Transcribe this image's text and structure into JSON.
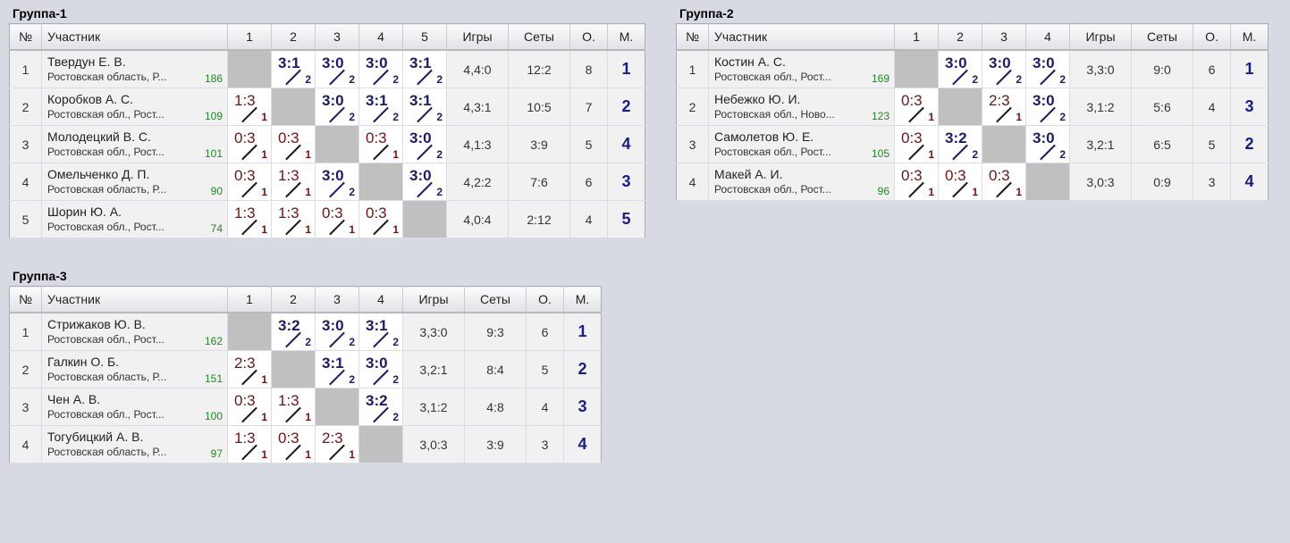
{
  "groups": [
    {
      "title": "Группа-1",
      "headers": {
        "num": "№",
        "name": "Участник",
        "games": "Игры",
        "sets": "Сеты",
        "points": "О.",
        "place": "М."
      },
      "rounds": [
        "1",
        "2",
        "3",
        "4",
        "5"
      ],
      "rows": [
        {
          "num": "1",
          "name": "Твердун Е. В.",
          "region": "Ростовская область, Р...",
          "rating": "186",
          "results": [
            {
              "self": true
            },
            {
              "score": "3:1",
              "pos": "2",
              "win": true
            },
            {
              "score": "3:0",
              "pos": "2",
              "win": true
            },
            {
              "score": "3:0",
              "pos": "2",
              "win": true
            },
            {
              "score": "3:1",
              "pos": "2",
              "win": true
            }
          ],
          "games": "4,4:0",
          "sets": "12:2",
          "points": "8",
          "place": "1"
        },
        {
          "num": "2",
          "name": "Коробков А. С.",
          "region": "Ростовская обл., Рост...",
          "rating": "109",
          "results": [
            {
              "score": "1:3",
              "pos": "1",
              "win": false
            },
            {
              "self": true
            },
            {
              "score": "3:0",
              "pos": "2",
              "win": true
            },
            {
              "score": "3:1",
              "pos": "2",
              "win": true
            },
            {
              "score": "3:1",
              "pos": "2",
              "win": true
            }
          ],
          "games": "4,3:1",
          "sets": "10:5",
          "points": "7",
          "place": "2"
        },
        {
          "num": "3",
          "name": "Молодецкий В. С.",
          "region": "Ростовская обл., Рост...",
          "rating": "101",
          "results": [
            {
              "score": "0:3",
              "pos": "1",
              "win": false
            },
            {
              "score": "0:3",
              "pos": "1",
              "win": false
            },
            {
              "self": true
            },
            {
              "score": "0:3",
              "pos": "1",
              "win": false
            },
            {
              "score": "3:0",
              "pos": "2",
              "win": true
            }
          ],
          "games": "4,1:3",
          "sets": "3:9",
          "points": "5",
          "place": "4"
        },
        {
          "num": "4",
          "name": "Омельченко Д. П.",
          "region": "Ростовская область, Р...",
          "rating": "90",
          "results": [
            {
              "score": "0:3",
              "pos": "1",
              "win": false
            },
            {
              "score": "1:3",
              "pos": "1",
              "win": false
            },
            {
              "score": "3:0",
              "pos": "2",
              "win": true
            },
            {
              "self": true
            },
            {
              "score": "3:0",
              "pos": "2",
              "win": true
            }
          ],
          "games": "4,2:2",
          "sets": "7:6",
          "points": "6",
          "place": "3"
        },
        {
          "num": "5",
          "name": "Шорин Ю. А.",
          "region": "Ростовская обл., Рост...",
          "rating": "74",
          "results": [
            {
              "score": "1:3",
              "pos": "1",
              "win": false
            },
            {
              "score": "1:3",
              "pos": "1",
              "win": false
            },
            {
              "score": "0:3",
              "pos": "1",
              "win": false
            },
            {
              "score": "0:3",
              "pos": "1",
              "win": false
            },
            {
              "self": true
            }
          ],
          "games": "4,0:4",
          "sets": "2:12",
          "points": "4",
          "place": "5"
        }
      ]
    },
    {
      "title": "Группа-2",
      "headers": {
        "num": "№",
        "name": "Участник",
        "games": "Игры",
        "sets": "Сеты",
        "points": "О.",
        "place": "М."
      },
      "rounds": [
        "1",
        "2",
        "3",
        "4"
      ],
      "rows": [
        {
          "num": "1",
          "name": "Костин А. С.",
          "region": "Ростовская обл., Рост...",
          "rating": "169",
          "results": [
            {
              "self": true
            },
            {
              "score": "3:0",
              "pos": "2",
              "win": true
            },
            {
              "score": "3:0",
              "pos": "2",
              "win": true
            },
            {
              "score": "3:0",
              "pos": "2",
              "win": true
            }
          ],
          "games": "3,3:0",
          "sets": "9:0",
          "points": "6",
          "place": "1"
        },
        {
          "num": "2",
          "name": "Небежко Ю. И.",
          "region": "Ростовская обл., Ново...",
          "rating": "123",
          "results": [
            {
              "score": "0:3",
              "pos": "1",
              "win": false
            },
            {
              "self": true
            },
            {
              "score": "2:3",
              "pos": "1",
              "win": false
            },
            {
              "score": "3:0",
              "pos": "2",
              "win": true
            }
          ],
          "games": "3,1:2",
          "sets": "5:6",
          "points": "4",
          "place": "3"
        },
        {
          "num": "3",
          "name": "Самолетов Ю. Е.",
          "region": "Ростовская обл., Рост...",
          "rating": "105",
          "results": [
            {
              "score": "0:3",
              "pos": "1",
              "win": false
            },
            {
              "score": "3:2",
              "pos": "2",
              "win": true
            },
            {
              "self": true
            },
            {
              "score": "3:0",
              "pos": "2",
              "win": true
            }
          ],
          "games": "3,2:1",
          "sets": "6:5",
          "points": "5",
          "place": "2"
        },
        {
          "num": "4",
          "name": "Макей А. И.",
          "region": "Ростовская обл., Рост...",
          "rating": "96",
          "results": [
            {
              "score": "0:3",
              "pos": "1",
              "win": false
            },
            {
              "score": "0:3",
              "pos": "1",
              "win": false
            },
            {
              "score": "0:3",
              "pos": "1",
              "win": false
            },
            {
              "self": true
            }
          ],
          "games": "3,0:3",
          "sets": "0:9",
          "points": "3",
          "place": "4"
        }
      ]
    },
    {
      "title": "Группа-3",
      "headers": {
        "num": "№",
        "name": "Участник",
        "games": "Игры",
        "sets": "Сеты",
        "points": "О.",
        "place": "М."
      },
      "rounds": [
        "1",
        "2",
        "3",
        "4"
      ],
      "rows": [
        {
          "num": "1",
          "name": "Стрижаков Ю. В.",
          "region": "Ростовская обл., Рост...",
          "rating": "162",
          "results": [
            {
              "self": true
            },
            {
              "score": "3:2",
              "pos": "2",
              "win": true
            },
            {
              "score": "3:0",
              "pos": "2",
              "win": true
            },
            {
              "score": "3:1",
              "pos": "2",
              "win": true
            }
          ],
          "games": "3,3:0",
          "sets": "9:3",
          "points": "6",
          "place": "1"
        },
        {
          "num": "2",
          "name": "Галкин О. Б.",
          "region": "Ростовская область, Р...",
          "rating": "151",
          "results": [
            {
              "score": "2:3",
              "pos": "1",
              "win": false
            },
            {
              "self": true
            },
            {
              "score": "3:1",
              "pos": "2",
              "win": true
            },
            {
              "score": "3:0",
              "pos": "2",
              "win": true
            }
          ],
          "games": "3,2:1",
          "sets": "8:4",
          "points": "5",
          "place": "2"
        },
        {
          "num": "3",
          "name": "Чен А. В.",
          "region": "Ростовская обл., Рост...",
          "rating": "100",
          "results": [
            {
              "score": "0:3",
              "pos": "1",
              "win": false
            },
            {
              "score": "1:3",
              "pos": "1",
              "win": false
            },
            {
              "self": true
            },
            {
              "score": "3:2",
              "pos": "2",
              "win": true
            }
          ],
          "games": "3,1:2",
          "sets": "4:8",
          "points": "4",
          "place": "3"
        },
        {
          "num": "4",
          "name": "Тогубицкий А. В.",
          "region": "Ростовская область, Р...",
          "rating": "97",
          "results": [
            {
              "score": "1:3",
              "pos": "1",
              "win": false
            },
            {
              "score": "0:3",
              "pos": "1",
              "win": false
            },
            {
              "score": "2:3",
              "pos": "1",
              "win": false
            },
            {
              "self": true
            }
          ],
          "games": "3,0:3",
          "sets": "3:9",
          "points": "3",
          "place": "4"
        }
      ]
    }
  ]
}
